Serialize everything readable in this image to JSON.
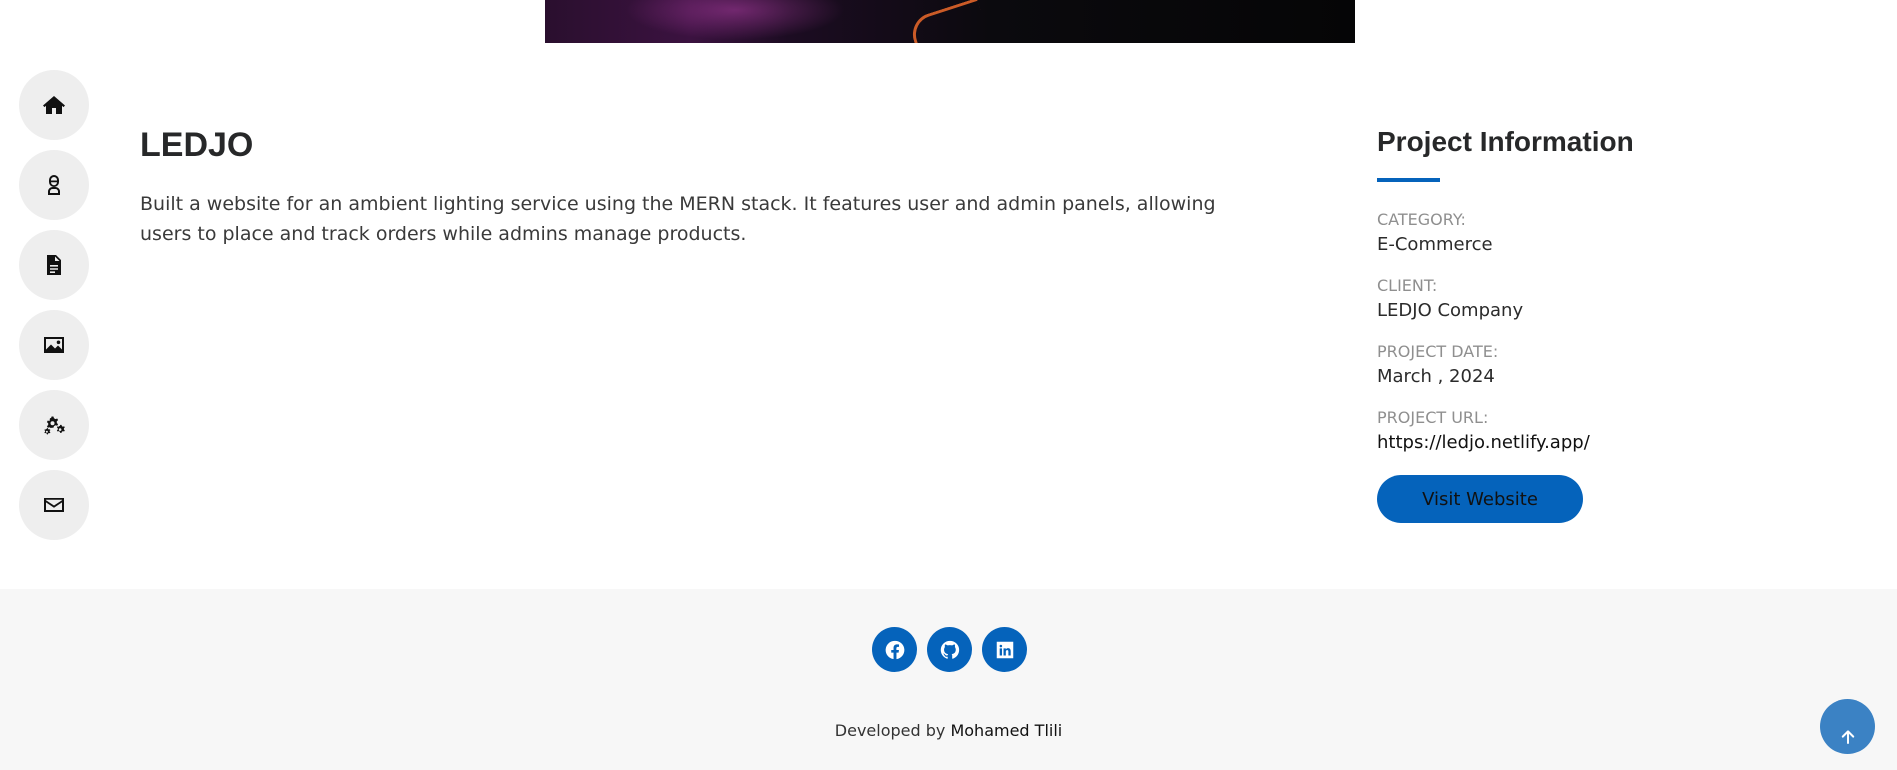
{
  "hero": {
    "image_name": "project-hero-image"
  },
  "side_nav": [
    {
      "name": "home",
      "icon": "home-icon"
    },
    {
      "name": "about",
      "icon": "user-icon"
    },
    {
      "name": "resume",
      "icon": "document-icon"
    },
    {
      "name": "portfolio",
      "icon": "image-icon"
    },
    {
      "name": "services",
      "icon": "gears-icon"
    },
    {
      "name": "contact",
      "icon": "envelope-icon"
    }
  ],
  "project": {
    "title": "LEDJO",
    "description": "Built a website for an ambient lighting service using the MERN stack. It features user and admin panels, allowing users to place and track orders while admins manage products."
  },
  "info": {
    "title": "Project Information",
    "items": [
      {
        "label": "CATEGORY:",
        "value": "E-Commerce"
      },
      {
        "label": "CLIENT:",
        "value": "LEDJO Company"
      },
      {
        "label": "PROJECT DATE:",
        "value": "March , 2024"
      },
      {
        "label": "PROJECT URL:",
        "value": "https://ledjo.netlify.app/"
      }
    ],
    "button_label": "Visit Website"
  },
  "footer": {
    "socials": [
      "facebook-icon",
      "github-icon",
      "linkedin-icon"
    ],
    "credit_prefix": "Developed by ",
    "credit_author": "Mohamed Tlili"
  },
  "colors": {
    "accent": "#0563bb",
    "nav_bg": "#eeeeee",
    "footer_bg": "#f7f7f7",
    "back_to_top": "#3b82c4"
  }
}
